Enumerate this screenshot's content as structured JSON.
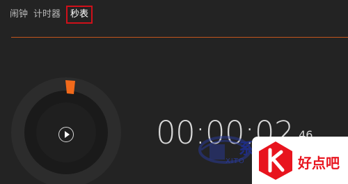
{
  "tabs": [
    {
      "label": "闹钟"
    },
    {
      "label": "计时器"
    },
    {
      "label": "秒表",
      "active": true
    }
  ],
  "stopwatch": {
    "time_main": "00:00:02",
    "time_fraction": ".46",
    "play_icon": "play-icon"
  },
  "watermarks": {
    "xitong_text": "系",
    "xitong_sub": "XITO",
    "haodianba_text": "好点吧"
  },
  "colors": {
    "accent": "#c4561c",
    "progress": "#f26a1b",
    "tab_highlight": "#d0101a",
    "watermark_red": "#e8141e"
  }
}
